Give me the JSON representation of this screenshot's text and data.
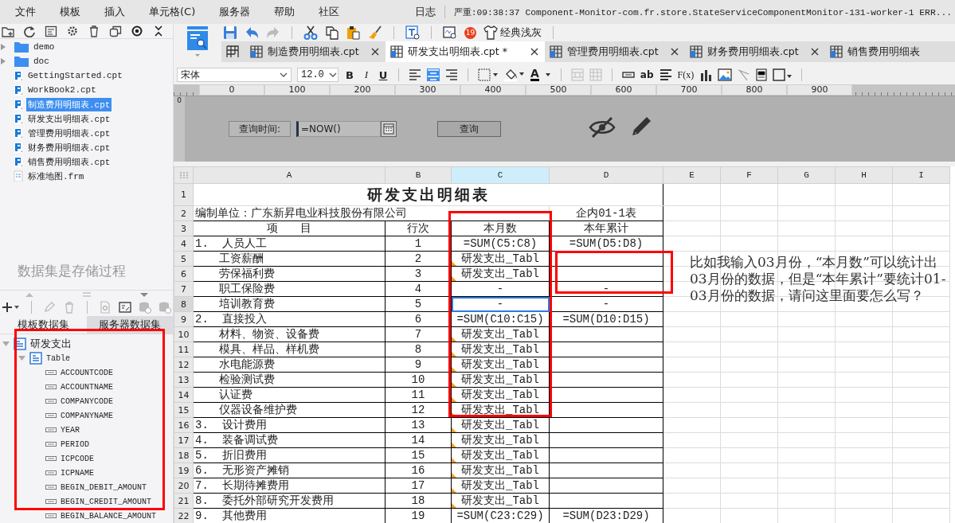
{
  "menu": [
    "文件",
    "模板",
    "插入",
    "单元格(C)",
    "服务器",
    "帮助",
    "社区"
  ],
  "log": {
    "label": "日志",
    "message": "严重:09:38:37 Component-Monitor-com.fr.store.StateServiceComponentMonitor-131-worker-1 ERR..."
  },
  "file_tree": [
    {
      "label": "demo",
      "kind": "folder",
      "selected": false
    },
    {
      "label": "doc",
      "kind": "folder",
      "selected": false
    },
    {
      "label": "GettingStarted.cpt",
      "kind": "report",
      "selected": false
    },
    {
      "label": "WorkBook2.cpt",
      "kind": "report",
      "selected": false
    },
    {
      "label": "制造费用明细表.cpt",
      "kind": "report",
      "selected": true
    },
    {
      "label": "研发支出明细表.cpt",
      "kind": "report",
      "selected": false
    },
    {
      "label": "管理费用明细表.cpt",
      "kind": "report",
      "selected": false
    },
    {
      "label": "财务费用明细表.cpt",
      "kind": "report",
      "selected": false
    },
    {
      "label": "销售费用明细表.cpt",
      "kind": "report",
      "selected": false
    },
    {
      "label": "标准地图.frm",
      "kind": "form",
      "selected": false
    }
  ],
  "dataset_caption": "数据集是存储过程",
  "dataset_tabs": [
    {
      "label": "模板数据集",
      "selected": true
    },
    {
      "label": "服务器数据集",
      "selected": false
    }
  ],
  "dataset_tree": [
    {
      "label": "研发支出",
      "kind": "dataset",
      "expanded": true,
      "children": [
        {
          "label": "Table",
          "kind": "table",
          "expanded": true,
          "children": [
            {
              "label": "ACCOUNTCODE",
              "kind": "field"
            },
            {
              "label": "ACCOUNTNAME",
              "kind": "field"
            },
            {
              "label": "COMPANYCODE",
              "kind": "field"
            },
            {
              "label": "COMPANYNAME",
              "kind": "field"
            },
            {
              "label": "YEAR",
              "kind": "field"
            },
            {
              "label": "PERIOD",
              "kind": "field"
            },
            {
              "label": "ICPCODE",
              "kind": "field"
            },
            {
              "label": "ICPNAME",
              "kind": "field"
            },
            {
              "label": "BEGIN_DEBIT_AMOUNT",
              "kind": "field"
            },
            {
              "label": "BEGIN_CREDIT_AMOUNT",
              "kind": "field"
            },
            {
              "label": "BEGIN_BALANCE_AMOUNT",
              "kind": "field"
            }
          ]
        }
      ]
    }
  ],
  "toolbar": {
    "badge": "19",
    "theme": "经典浅灰"
  },
  "tabs": [
    {
      "label": "制造费用明细表.cpt",
      "selected": false,
      "closable": true
    },
    {
      "label": "研发支出明细表.cpt *",
      "selected": true,
      "closable": true
    },
    {
      "label": "管理费用明细表.cpt",
      "selected": false,
      "closable": true
    },
    {
      "label": "财务费用明细表.cpt",
      "selected": false,
      "closable": true
    },
    {
      "label": "销售费用明细表",
      "selected": false,
      "closable": false
    }
  ],
  "format": {
    "font": "宋体",
    "size": "12.0",
    "bold": "B",
    "italic": "I",
    "underline": "U",
    "align": [
      {
        "kind": "left",
        "selected": false
      },
      {
        "kind": "center",
        "selected": true
      },
      {
        "kind": "right",
        "selected": false
      }
    ],
    "font_color": "A",
    "wrap": "ab",
    "formula": "F(x)"
  },
  "parameters": {
    "ruler": [
      "0",
      "100",
      "200",
      "300",
      "400",
      "500",
      "600",
      "700",
      "800",
      "900"
    ],
    "vertical_ruler": "0",
    "label": "查询时间:",
    "field_value": "=NOW()",
    "button": "查询"
  },
  "sheet": {
    "columns": [
      {
        "label": "A",
        "selected": false
      },
      {
        "label": "B",
        "selected": false
      },
      {
        "label": "C",
        "selected": true
      },
      {
        "label": "D",
        "selected": false
      },
      {
        "label": "E",
        "selected": false
      },
      {
        "label": "F",
        "selected": false
      },
      {
        "label": "G",
        "selected": false
      },
      {
        "label": "H",
        "selected": false
      },
      {
        "label": "I",
        "selected": false
      }
    ],
    "rows": [
      {
        "number": "1",
        "kind": "title",
        "selected": false,
        "col_a": "研发支出明细表"
      },
      {
        "number": "2",
        "kind": "info",
        "selected": false,
        "col_a": "编制单位：广东新昇电业科技股份有限公司",
        "col_d": "企内01-1表"
      },
      {
        "number": "3",
        "kind": "header",
        "selected": false,
        "col_a": "项　　目",
        "col_b": "行次",
        "col_c": "本月数",
        "col_d": "本年累计"
      },
      {
        "number": "4",
        "kind": "group",
        "selected": false,
        "col_a": "1.  人员人工",
        "col_b": "1",
        "col_c": "=SUM(C5:C8)",
        "col_d": "=SUM(D5:D8)"
      },
      {
        "number": "5",
        "kind": "detail",
        "selected": false,
        "marked": true,
        "col_a": "工资薪酬",
        "col_b": "2",
        "col_c": "研发支出_Tabl"
      },
      {
        "number": "6",
        "kind": "detail",
        "selected": false,
        "marked": true,
        "col_a": "劳保福利费",
        "col_b": "3",
        "col_c": "研发支出_Tabl"
      },
      {
        "number": "7",
        "kind": "detail",
        "selected": false,
        "col_a": "职工保险费",
        "col_b": "4",
        "col_c": "-",
        "col_d": "-"
      },
      {
        "number": "8",
        "kind": "detail",
        "selected": true,
        "col_a": "培训教育费",
        "col_b": "5",
        "col_c": "-",
        "col_d": "-"
      },
      {
        "number": "9",
        "kind": "group",
        "selected": false,
        "col_a": "2.  直接投入",
        "col_b": "6",
        "col_c": "=SUM(C10:C15)",
        "col_d": "=SUM(D10:D15)"
      },
      {
        "number": "10",
        "kind": "detail",
        "selected": false,
        "marked": true,
        "col_a": "材料、物资、设备费",
        "col_b": "7",
        "col_c": "研发支出_Tabl"
      },
      {
        "number": "11",
        "kind": "detail",
        "selected": false,
        "marked": true,
        "col_a": "模具、样品、样机费",
        "col_b": "8",
        "col_c": "研发支出_Tabl"
      },
      {
        "number": "12",
        "kind": "detail",
        "selected": false,
        "marked": true,
        "col_a": "水电能源费",
        "col_b": "9",
        "col_c": "研发支出_Tabl"
      },
      {
        "number": "13",
        "kind": "detail",
        "selected": false,
        "marked": true,
        "col_a": "检验测试费",
        "col_b": "10",
        "col_c": "研发支出_Tabl"
      },
      {
        "number": "14",
        "kind": "detail",
        "selected": false,
        "marked": true,
        "col_a": "认证费",
        "col_b": "11",
        "col_c": "研发支出_Tabl"
      },
      {
        "number": "15",
        "kind": "detail",
        "selected": false,
        "marked": true,
        "col_a": "仪器设备维护费",
        "col_b": "12",
        "col_c": "研发支出_Tabl"
      },
      {
        "number": "16",
        "kind": "group",
        "selected": false,
        "marked": true,
        "col_a": "3.  设计费用",
        "col_b": "13",
        "col_c": "研发支出_Tabl"
      },
      {
        "number": "17",
        "kind": "group",
        "selected": false,
        "marked": true,
        "col_a": "4.  装备调试费",
        "col_b": "14",
        "col_c": "研发支出_Tabl"
      },
      {
        "number": "18",
        "kind": "group",
        "selected": false,
        "marked": true,
        "col_a": "5.  折旧费用",
        "col_b": "15",
        "col_c": "研发支出_Tabl"
      },
      {
        "number": "19",
        "kind": "group",
        "selected": false,
        "marked": true,
        "col_a": "6.  无形资产摊销",
        "col_b": "16",
        "col_c": "研发支出_Tabl"
      },
      {
        "number": "20",
        "kind": "group",
        "selected": false,
        "marked": true,
        "col_a": "7.  长期待摊费用",
        "col_b": "17",
        "col_c": "研发支出_Tabl"
      },
      {
        "number": "21",
        "kind": "group",
        "selected": false,
        "marked": true,
        "col_a": "8.  委托外部研究开发费用",
        "col_b": "18",
        "col_c": "研发支出_Tabl"
      },
      {
        "number": "22",
        "kind": "group",
        "selected": false,
        "col_a": "9.  其他费用",
        "col_b": "19",
        "col_c": "=SUM(C23:C29)",
        "col_d": "=SUM(D23:D29)"
      }
    ]
  },
  "note": "比如我输入03月份，“本月数”可以统计出03月份的数据，但是“本年累计”要统计01-03月份的数据，请问这里面要怎么写？"
}
